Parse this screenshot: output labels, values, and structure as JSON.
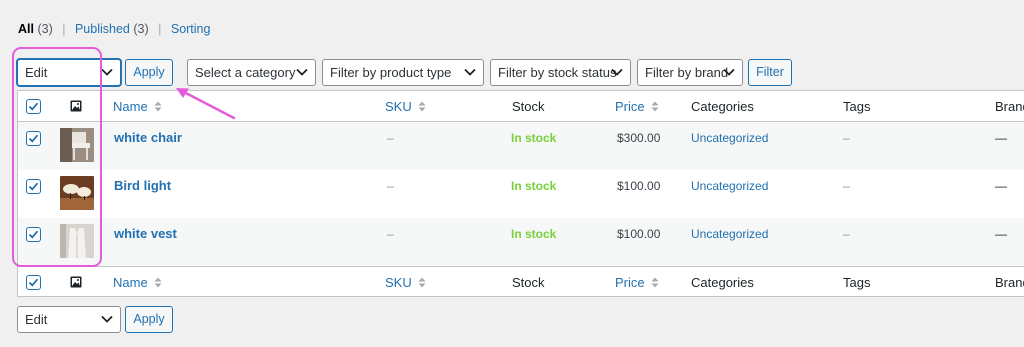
{
  "views": {
    "all_label": "All",
    "all_count": "(3)",
    "separator": "|",
    "published_label": "Published",
    "published_count": "(3)",
    "sorting_label": "Sorting"
  },
  "top_actions": {
    "bulk_action_selected": "Edit",
    "apply_label": "Apply",
    "category_filter": "Select a category",
    "product_type_filter": "Filter by product type",
    "stock_status_filter": "Filter by stock status",
    "brand_filter": "Filter by brand",
    "filter_button": "Filter"
  },
  "columns": {
    "name": "Name",
    "sku": "SKU",
    "stock": "Stock",
    "price": "Price",
    "categories": "Categories",
    "tags": "Tags",
    "brands": "Brand"
  },
  "products": [
    {
      "name": "white chair",
      "sku": "–",
      "stock": "In stock",
      "price": "$300.00",
      "category": "Uncategorized",
      "tags": "–",
      "brand": "—",
      "checked": true
    },
    {
      "name": "Bird light",
      "sku": "–",
      "stock": "In stock",
      "price": "$100.00",
      "category": "Uncategorized",
      "tags": "–",
      "brand": "—",
      "checked": true
    },
    {
      "name": "white vest",
      "sku": "–",
      "stock": "In stock",
      "price": "$100.00",
      "category": "Uncategorized",
      "tags": "–",
      "brand": "—",
      "checked": true
    }
  ],
  "bottom_actions": {
    "bulk_action_selected": "Edit",
    "apply_label": "Apply"
  },
  "colors": {
    "link": "#2271b1",
    "in_stock": "#7ad03a",
    "highlight": "#e35ddb"
  }
}
